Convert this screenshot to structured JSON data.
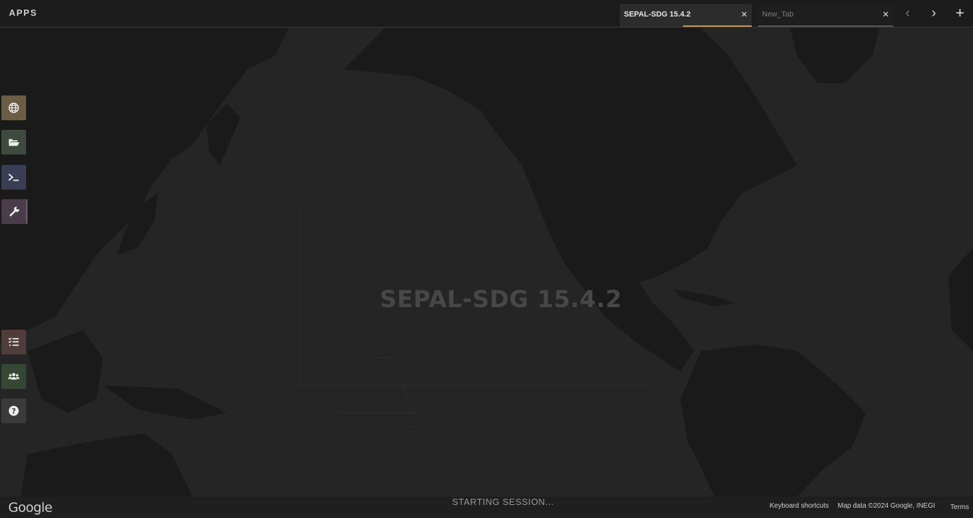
{
  "header": {
    "app_title": "APPS",
    "tabs": [
      {
        "label": "SEPAL-SDG 15.4.2",
        "close": "✕",
        "active": true
      },
      {
        "label": "New_Tab",
        "close": "✕",
        "active": false
      }
    ],
    "nav": {
      "prev": "‹",
      "next": "›",
      "add": "+"
    }
  },
  "map": {
    "watermark": "SEPAL-SDG 15.4.2"
  },
  "sidebar": {
    "top": [
      {
        "icon": "globe-icon",
        "color": "#6b5d45"
      },
      {
        "icon": "folder-open-icon",
        "color": "#3d4a3d"
      },
      {
        "icon": "terminal-icon",
        "color": "#3a3e55"
      },
      {
        "icon": "wrench-icon",
        "color": "#4a3d4a"
      }
    ],
    "bottom": [
      {
        "icon": "tasks-icon",
        "color": "#513c3c"
      },
      {
        "icon": "users-icon",
        "color": "#344834"
      },
      {
        "icon": "help-icon",
        "color": "#3a3a3a"
      }
    ]
  },
  "footer": {
    "logo": "Google",
    "status": "STARTING SESSION...",
    "shortcuts": "Keyboard shortcuts",
    "map_data": "Map data ©2024 Google, INEGI",
    "terms": "Terms"
  }
}
